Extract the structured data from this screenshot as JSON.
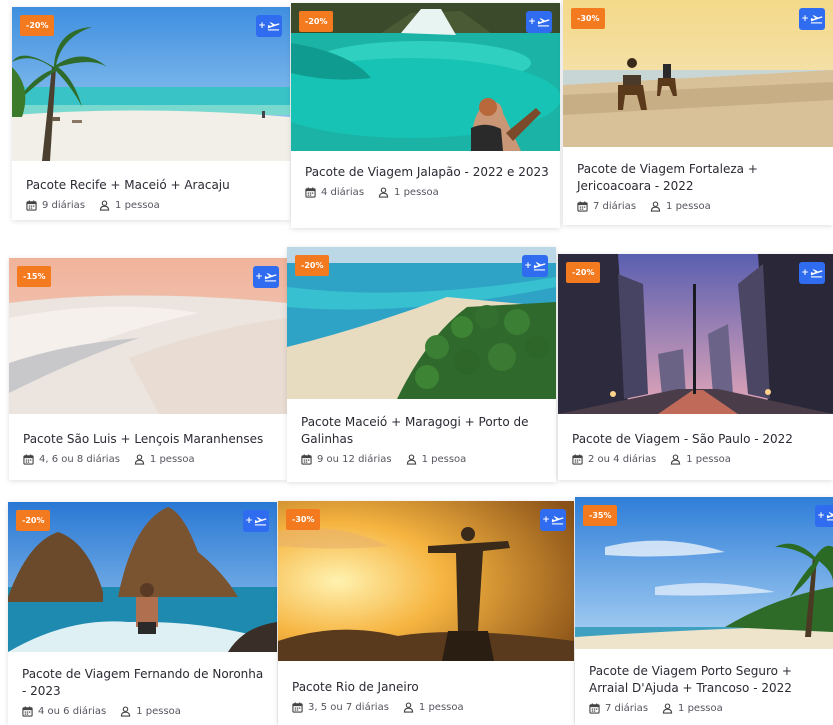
{
  "add_label": "+",
  "cards": [
    {
      "badge": "-20%",
      "title": "Pacote Recife + Maceió + Aracaju",
      "nights": "9 diárias",
      "people": "1 pessoa"
    },
    {
      "badge": "-20%",
      "title": "Pacote de Viagem Jalapão - 2022 e 2023",
      "nights": "4 diárias",
      "people": "1 pessoa"
    },
    {
      "badge": "-30%",
      "title": "Pacote de Viagem Fortaleza + Jericoacoara - 2022",
      "nights": "7 diárias",
      "people": "1 pessoa"
    },
    {
      "badge": "-15%",
      "title": "Pacote São Luis + Lençois Maranhenses",
      "nights": "4, 6 ou 8 diárias",
      "people": "1 pessoa"
    },
    {
      "badge": "-20%",
      "title": "Pacote Maceió + Maragogi + Porto de Galinhas",
      "nights": "9 ou 12 diárias",
      "people": "1 pessoa"
    },
    {
      "badge": "-20%",
      "title": "Pacote de Viagem - São Paulo - 2022",
      "nights": "2 ou 4 diárias",
      "people": "1 pessoa"
    },
    {
      "badge": "-20%",
      "title": "Pacote de Viagem Fernando de Noronha - 2023",
      "nights": "4 ou 6 diárias",
      "people": "1 pessoa"
    },
    {
      "badge": "-30%",
      "title": "Pacote Rio de Janeiro",
      "nights": "3, 5 ou 7 diárias",
      "people": "1 pessoa"
    },
    {
      "badge": "-35%",
      "title": "Pacote de Viagem Porto Seguro + Arraial D'Ajuda + Trancoso - 2022",
      "nights": "7 diárias",
      "people": "1 pessoa"
    }
  ],
  "colors": {
    "badge": "#f47a1f",
    "add_button": "#2f6cf0"
  }
}
